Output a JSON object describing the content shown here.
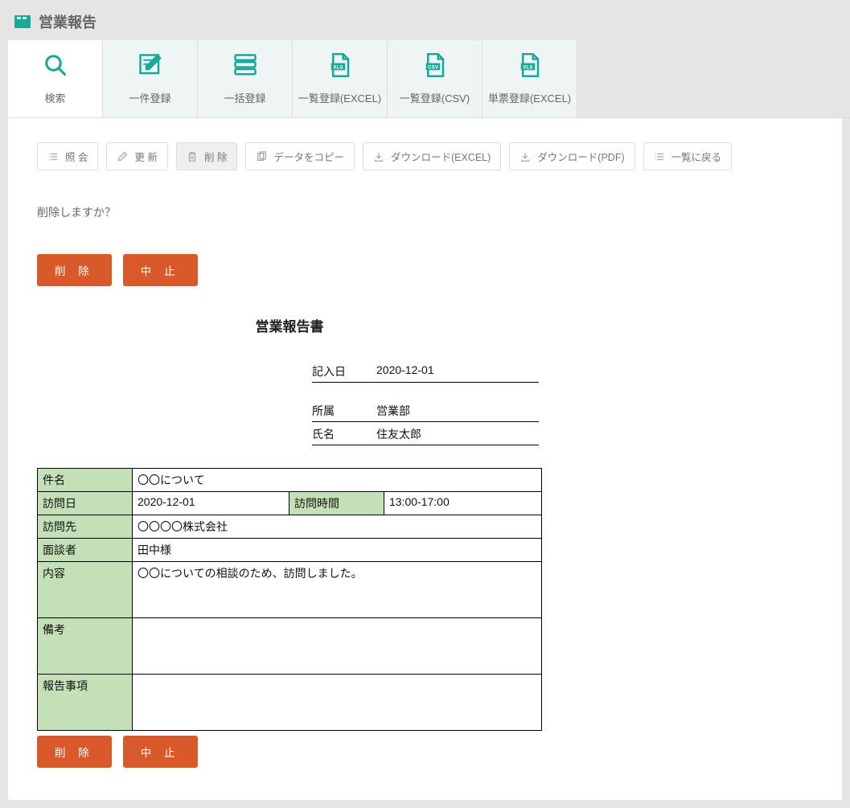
{
  "page_title": "営業報告",
  "tabs": [
    {
      "label": "検索"
    },
    {
      "label": "一件登録"
    },
    {
      "label": "一括登録"
    },
    {
      "label": "一覧登録(EXCEL)"
    },
    {
      "label": "一覧登録(CSV)"
    },
    {
      "label": "単票登録(EXCEL)"
    }
  ],
  "actions": {
    "view": "照 会",
    "edit": "更 新",
    "delete": "削 除",
    "copy": "データをコピー",
    "dl_xls": "ダウンロード(EXCEL)",
    "dl_pdf": "ダウンロード(PDF)",
    "back": "一覧に戻る"
  },
  "confirm_text": "削除しますか？",
  "primary": {
    "delete": "削 除",
    "cancel": "中 止"
  },
  "report": {
    "title": "営業報告書",
    "meta": {
      "entry_date_label": "記入日",
      "entry_date": "2020-12-01",
      "dept_label": "所属",
      "dept": "営業部",
      "name_label": "氏名",
      "name": "住友太郎"
    },
    "fields": {
      "subject_label": "件名",
      "subject": "〇〇について",
      "visit_date_label": "訪問日",
      "visit_date": "2020-12-01",
      "visit_time_label": "訪問時間",
      "visit_time": "13:00-17:00",
      "visit_dest_label": "訪問先",
      "visit_dest": "〇〇〇〇株式会社",
      "interviewee_label": "面談者",
      "interviewee": "田中様",
      "content_label": "内容",
      "content": "〇〇についての相談のため、訪問しました。",
      "remarks_label": "備考",
      "remarks": "",
      "report_items_label": "報告事項",
      "report_items": ""
    }
  }
}
